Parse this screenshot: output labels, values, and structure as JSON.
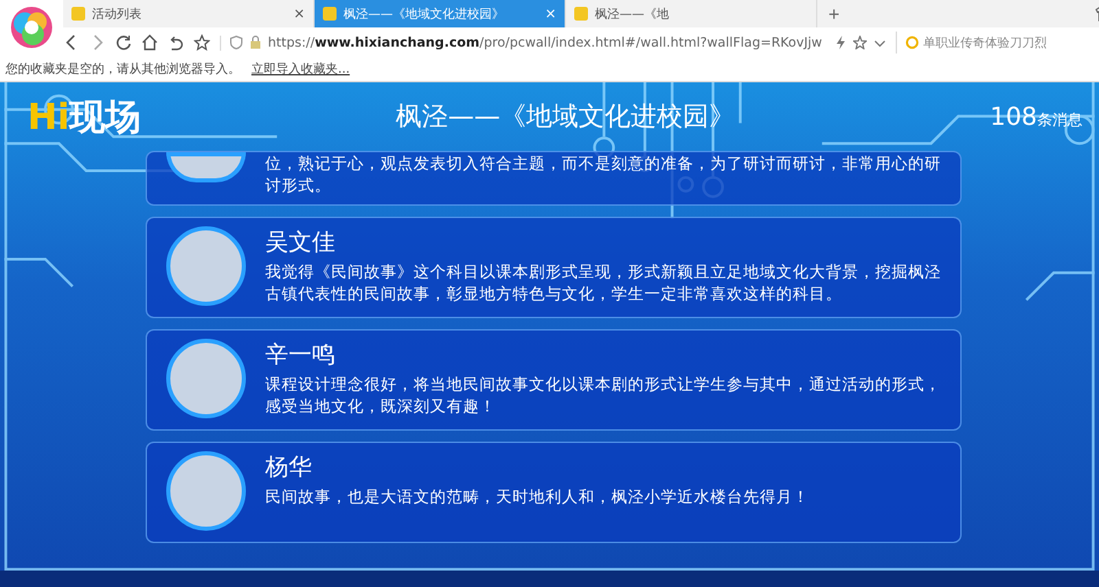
{
  "browser": {
    "tabs": [
      {
        "label": "活动列表",
        "selected": false,
        "close": "×"
      },
      {
        "label": "枫泾——《地域文化进校园》",
        "selected": true,
        "close": "×"
      },
      {
        "label": "枫泾——《地",
        "selected": false
      }
    ],
    "new_tab": "+",
    "url": "https://**www.hixianchang.com**/pro/pcwall/index.html#/wall.html?wallFlag=RKovJjw",
    "search": {
      "value": "单职业传奇体验刀刀烈"
    },
    "bookmarks_notice": "您的收藏夹是空的，请从其他浏览器导入。",
    "bookmarks_link": "立即导入收藏夹..."
  },
  "wall": {
    "logo_prefix": "Hi",
    "logo_text": "现场",
    "title": "枫泾——《地域文化进校园》",
    "count": "108",
    "count_unit": "条消息",
    "messages": [
      {
        "kind": "partial",
        "text": "位，熟记于心，观点发表切入符合主题，而不是刻意的准备，为了研讨而研讨，非常用心的研讨形式。"
      },
      {
        "kind": "full",
        "name": "吴文佳",
        "text": "我觉得《民间故事》这个科目以课本剧形式呈现，形式新颖且立足地域文化大背景，挖掘枫泾古镇代表性的民间故事，彰显地方特色与文化，学生一定非常喜欢这样的科目。"
      },
      {
        "kind": "full",
        "name": "辛一鸣",
        "text": "课程设计理念很好，将当地民间故事文化以课本剧的形式让学生参与其中，通过活动的形式，感受当地文化，既深刻又有趣！"
      },
      {
        "kind": "full",
        "name": "杨华",
        "text": "民间故事，也是大语文的范畴，天时地利人和，枫泾小学近水楼台先得月！"
      }
    ]
  }
}
